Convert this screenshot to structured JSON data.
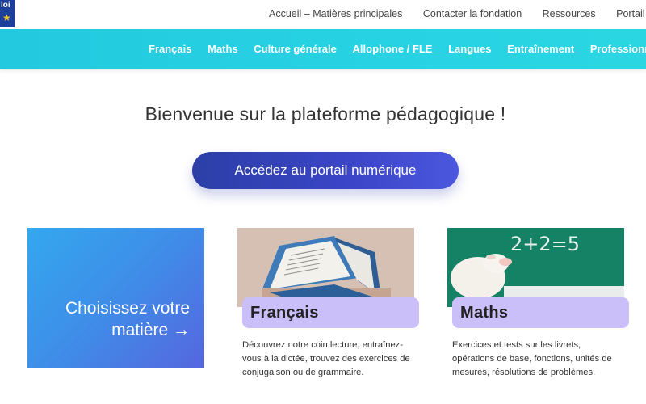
{
  "header": {
    "logo_text": "loi",
    "links": [
      "Accueil – Matières principales",
      "Contacter la fondation",
      "Ressources",
      "Portail nu"
    ]
  },
  "nav": {
    "items": [
      "Français",
      "Maths",
      "Culture générale",
      "Allophone / FLE",
      "Langues",
      "Entraînement",
      "Professionnel"
    ]
  },
  "hero": {
    "title": "Bienvenue sur la plateforme pédagogique !",
    "cta_label": "Accédez au portail numérique"
  },
  "choose": {
    "line1": "Choisissez votre",
    "line2": "matière →"
  },
  "cards": [
    {
      "title": "Français",
      "description": "Découvrez notre coin lecture, entraînez-vous à la dictée, trouvez des exercices de conjugaison ou de grammaire."
    },
    {
      "title": "Maths",
      "board_text": "2+2=5",
      "description": "Exercices et tests sur les livrets, opérations de base, fonctions, unités de mesures, résolutions de problèmes."
    }
  ],
  "colors": {
    "nav_bg": "#27d3e3",
    "cta_bg": "#3b45c8",
    "card_label_bg": "#cbbff9",
    "choose_bg": "#3f8de8"
  }
}
